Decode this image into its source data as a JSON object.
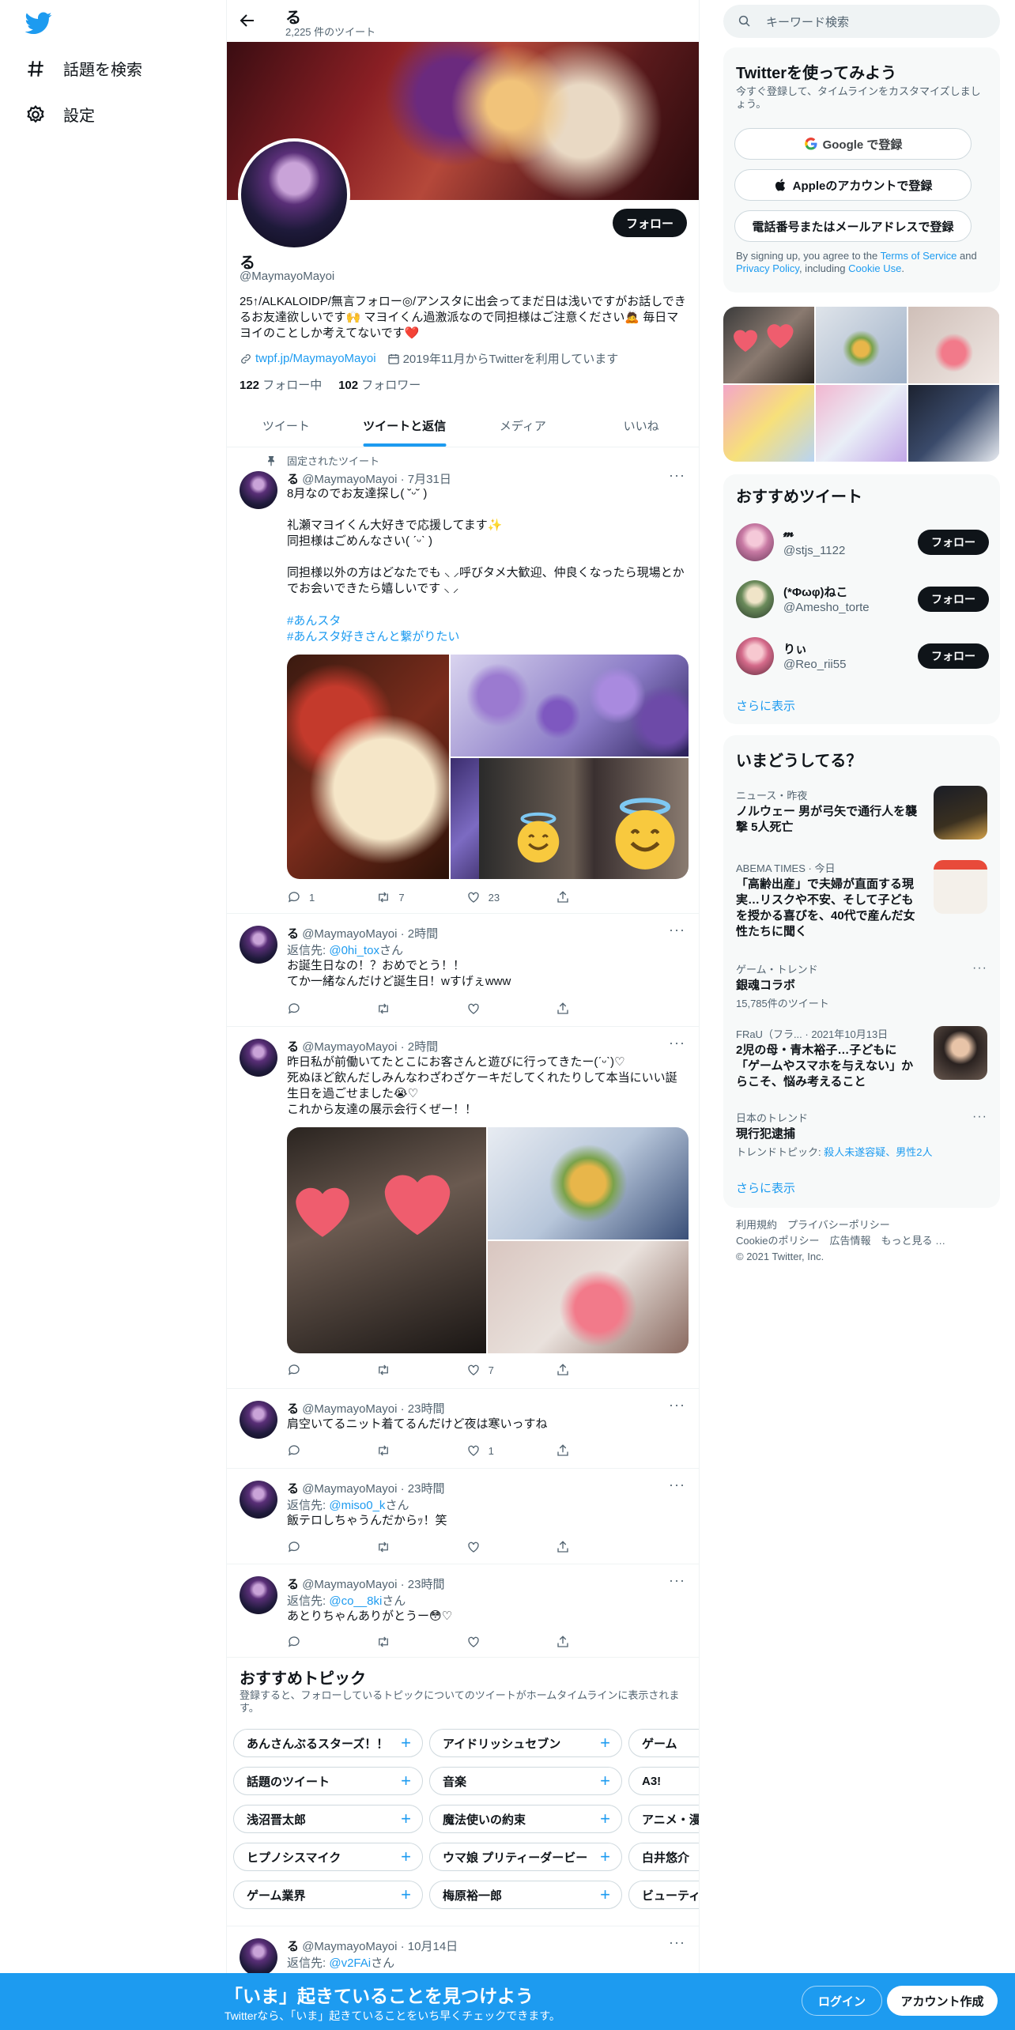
{
  "nav": {
    "explore_label": "話題を検索",
    "settings_label": "設定"
  },
  "profile": {
    "top_name": "る",
    "tweet_count": "2,225 件のツイート",
    "follow_label": "フォロー",
    "name": "る",
    "handle": "@MaymayoMayoi",
    "bio": "25↑/ALKALOIDP/無言フォロー◎/アンスタに出会ってまだ日は浅いですがお話しできるお友達欲しいです🙌 マヨイくん過激派なので同担様はご注意ください🙇 毎日マヨイのことしか考えてないです❤️",
    "link": "twpf.jp/MaymayoMayoi",
    "joined": "2019年11月からTwitterを利用しています",
    "following_count": "122",
    "following_label": "フォロー中",
    "followers_count": "102",
    "followers_label": "フォロワー"
  },
  "tabs": [
    "ツイート",
    "ツイートと返信",
    "メディア",
    "いいね"
  ],
  "tweets": [
    {
      "pinned_label": "固定されたツイート",
      "name": "る",
      "handle": "@MaymayoMayoi",
      "time": "7月31日",
      "text": "8月なのでお友達探し( ˘ᵕ˘ )\n\n礼瀬マヨイくん大好きで応援してます✨\n同担様はごめんなさい( ˊᵕˋ )\n\n同担様以外の方はどなたでも‪‪ ‪‪‪‪‪⸜‪‪ ‪‪‪‪‪⸝‪‪呼びタメ大歓迎、仲良くなったら現場とかでお会いできたら嬉しいです‪‪ ‪‪‪‪‪⸜‪‪ ‪‪‪‪‪⸝‪‪‪‪",
      "hashtags": [
        "#あんスタ",
        "#あんスタ好きさんと繋がりたい"
      ],
      "replies": "1",
      "retweets": "7",
      "likes": "23"
    },
    {
      "name": "る",
      "handle": "@MaymayoMayoi",
      "time": "2時間",
      "reply_prefix": "返信先: ",
      "reply_to": "@0hi_tox",
      "reply_suffix": "さん",
      "text": "お誕生日なの！？おめでとう！！\nてか一緒なんだけど誕生日！wすげぇwww"
    },
    {
      "name": "る",
      "handle": "@MaymayoMayoi",
      "time": "2時間",
      "text": "昨日私が前働いてたとこにお客さんと遊びに行ってきたー(ˊᵕˋ)♡\n死ぬほど飲んだしみんなわざわざケーキだしてくれたりして本当にいい誕生日を過ごせました😭♡\nこれから友達の展示会行くぜー！！",
      "likes": "7"
    },
    {
      "name": "る",
      "handle": "@MaymayoMayoi",
      "time": "23時間",
      "text": "肩空いてるニット着てるんだけど夜は寒いっすね",
      "likes": "1"
    },
    {
      "name": "る",
      "handle": "@MaymayoMayoi",
      "time": "23時間",
      "reply_prefix": "返信先: ",
      "reply_to": "@miso0_k",
      "reply_suffix": "さん",
      "text": "飯テロしちゃうんだからｯ！笑"
    },
    {
      "name": "る",
      "handle": "@MaymayoMayoi",
      "time": "23時間",
      "reply_prefix": "返信先: ",
      "reply_to": "@co__8ki",
      "reply_suffix": "さん",
      "text": "あとりちゃんありがとうー😳♡"
    },
    {
      "name": "る",
      "handle": "@MaymayoMayoi",
      "time": "10月14日",
      "reply_prefix": "返信先: ",
      "reply_to": "@v2FAi",
      "reply_suffix": "さん"
    }
  ],
  "topics": {
    "title": "おすすめトピック",
    "subtitle": "登録すると、フォローしているトピックについてのツイートがホームタイムラインに表示されます。",
    "chips": [
      "あんさんぶるスターズ！！",
      "アイドリッシュセブン",
      "ゲーム",
      "話題のツイート",
      "音楽",
      "A3!",
      "浅沼晋太郎",
      "魔法使いの約束",
      "アニメ・漫",
      "ヒプノシスマイク",
      "ウマ娘 プリティーダービー",
      "白井悠介",
      "ゲーム業界",
      "梅原裕一郎",
      "ビューティ"
    ]
  },
  "search": {
    "placeholder": "キーワード検索"
  },
  "signup": {
    "title": "Twitterを使ってみよう",
    "subtitle": "今すぐ登録して、タイムラインをカスタマイズしましょう。",
    "google": "Google で登録",
    "apple": "Appleのアカウントで登録",
    "phone": "電話番号またはメールアドレスで登録",
    "terms_1": "By signing up, you agree to the ",
    "terms_tos": "Terms of Service",
    "terms_2": " and ",
    "terms_privacy": "Privacy Policy",
    "terms_3": ", including ",
    "terms_cookie": "Cookie Use",
    "terms_4": "."
  },
  "who_to_follow": {
    "title": "おすすめツイート",
    "follow_label": "フォロー",
    "more": "さらに表示",
    "users": [
      {
        "name": "𝓶",
        "handle": "@stjs_1122"
      },
      {
        "name": "(*Φωφ)ねこ",
        "handle": "@Amesho_torte"
      },
      {
        "name": "りぃ",
        "handle": "@Reo_rii55"
      }
    ]
  },
  "trends": {
    "title": "いまどうしてる？",
    "more": "さらに表示",
    "items": [
      {
        "meta": "ニュース・昨夜",
        "title": "ノルウェー 男が弓矢で通行人を襲撃 5人死亡"
      },
      {
        "meta": "ABEMA TIMES · 今日",
        "title": "「高齢出産」で夫婦が直面する現実…リスクや不安、そして子どもを授かる喜びを、40代で産んだ女性たちに聞く"
      },
      {
        "meta": "ゲーム・トレンド",
        "title": "銀魂コラボ",
        "sub": "15,785件のツイート"
      },
      {
        "meta": "FRaU（フラ... · 2021年10月13日",
        "title": "2児の母・青木裕子…子どもに「ゲームやスマホを与えない」からこそ、悩み考えること"
      },
      {
        "meta": "日本のトレンド",
        "title": "現行犯逮捕",
        "sub_prefix": "トレンドトピック: ",
        "sub_links": "殺人未遂容疑、男性2人"
      }
    ]
  },
  "footer": {
    "links_1": "利用規約　プライバシーポリシー",
    "links_2": "Cookieのポリシー　広告情報　もっと見る …",
    "copyright": "© 2021 Twitter, Inc."
  },
  "bottombar": {
    "title": "「いま」起きていることを見つけよう",
    "subtitle": "Twitterなら、「いま」起きていることをいち早くチェックできます。",
    "login": "ログイン",
    "signup": "アカウント作成"
  },
  "colors": {
    "accent": "#1d9bf0",
    "text": "#0f1419",
    "muted": "#536471"
  }
}
